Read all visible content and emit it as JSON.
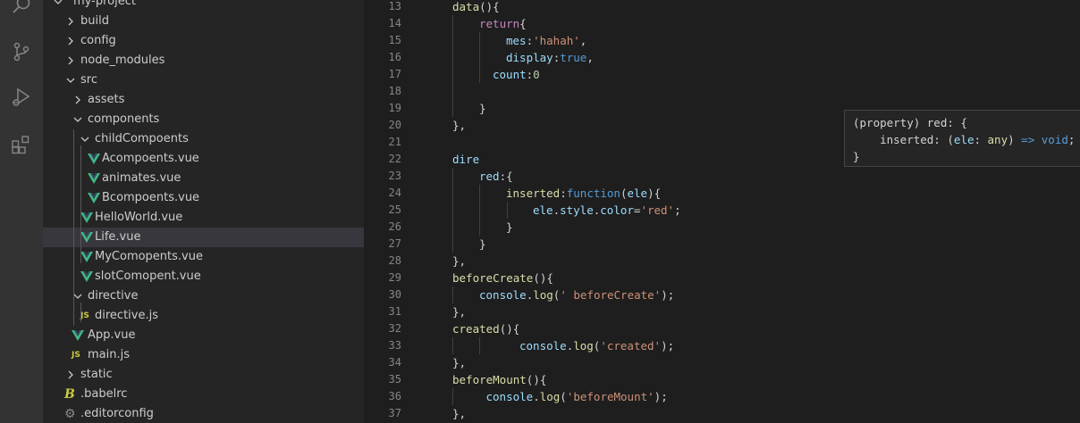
{
  "explorer": {
    "items": [
      {
        "label": "my-project",
        "kind": "folder",
        "open": true,
        "depth": 0
      },
      {
        "label": "build",
        "kind": "folder",
        "open": false,
        "depth": 1
      },
      {
        "label": "config",
        "kind": "folder",
        "open": false,
        "depth": 1
      },
      {
        "label": "node_modules",
        "kind": "folder",
        "open": false,
        "depth": 1
      },
      {
        "label": "src",
        "kind": "folder",
        "open": true,
        "depth": 1
      },
      {
        "label": "assets",
        "kind": "folder",
        "open": false,
        "depth": 2
      },
      {
        "label": "components",
        "kind": "folder",
        "open": true,
        "depth": 2
      },
      {
        "label": "childCompoents",
        "kind": "folder",
        "open": true,
        "depth": 3
      },
      {
        "label": "Acompoents.vue",
        "kind": "vue",
        "depth": 4
      },
      {
        "label": "animates.vue",
        "kind": "vue",
        "depth": 4
      },
      {
        "label": "Bcompoents.vue",
        "kind": "vue",
        "depth": 4
      },
      {
        "label": "HelloWorld.vue",
        "kind": "vue",
        "depth": 3
      },
      {
        "label": "Life.vue",
        "kind": "vue",
        "depth": 3,
        "selected": true
      },
      {
        "label": "MyComopents.vue",
        "kind": "vue",
        "depth": 3
      },
      {
        "label": "slotComopent.vue",
        "kind": "vue",
        "depth": 3
      },
      {
        "label": "directive",
        "kind": "folder",
        "open": true,
        "depth": 2
      },
      {
        "label": "directive.js",
        "kind": "js",
        "depth": 3
      },
      {
        "label": "App.vue",
        "kind": "vue",
        "depth": 2
      },
      {
        "label": "main.js",
        "kind": "js",
        "depth": 2
      },
      {
        "label": "static",
        "kind": "folder",
        "open": false,
        "depth": 1
      },
      {
        "label": ".babelrc",
        "kind": "babel",
        "depth": 1
      },
      {
        "label": ".editorconfig",
        "kind": "config",
        "depth": 1
      }
    ]
  },
  "editor": {
    "lines": [
      {
        "n": "13",
        "indent": 0,
        "tokens": [
          {
            "t": "data",
            "c": "fn"
          },
          {
            "t": "(){",
            "c": "pun"
          }
        ]
      },
      {
        "n": "14",
        "indent": 1,
        "tokens": [
          {
            "t": "return",
            "c": "kw"
          },
          {
            "t": "{",
            "c": "pun"
          }
        ]
      },
      {
        "n": "15",
        "indent": 2,
        "tokens": [
          {
            "t": "mes",
            "c": "prop"
          },
          {
            "t": ":",
            "c": "pun"
          },
          {
            "t": "'hahah'",
            "c": "str"
          },
          {
            "t": ",",
            "c": "pun"
          }
        ]
      },
      {
        "n": "16",
        "indent": 2,
        "tokens": [
          {
            "t": "display",
            "c": "prop"
          },
          {
            "t": ":",
            "c": "pun"
          },
          {
            "t": "true",
            "c": "bool"
          },
          {
            "t": ",",
            "c": "pun"
          }
        ]
      },
      {
        "n": "17",
        "indent": 1.5,
        "tokens": [
          {
            "t": "count",
            "c": "prop"
          },
          {
            "t": ":",
            "c": "pun"
          },
          {
            "t": "0",
            "c": "num"
          }
        ]
      },
      {
        "n": "18",
        "indent": 0,
        "tokens": []
      },
      {
        "n": "19",
        "indent": 1,
        "tokens": [
          {
            "t": "}",
            "c": "pun"
          }
        ]
      },
      {
        "n": "20",
        "indent": 0,
        "tokens": [
          {
            "t": "},",
            "c": "pun"
          }
        ]
      },
      {
        "n": "21",
        "indent": 0,
        "tokens": []
      },
      {
        "n": "22",
        "indent": 0,
        "tokens": [
          {
            "t": "dire",
            "c": "prop"
          }
        ]
      },
      {
        "n": "23",
        "indent": 1,
        "tokens": [
          {
            "t": "red",
            "c": "prop"
          },
          {
            "t": ":{",
            "c": "pun"
          }
        ]
      },
      {
        "n": "24",
        "indent": 2,
        "tokens": [
          {
            "t": "inserted",
            "c": "fn"
          },
          {
            "t": ":",
            "c": "pun"
          },
          {
            "t": "function",
            "c": "bool"
          },
          {
            "t": "(",
            "c": "pun"
          },
          {
            "t": "ele",
            "c": "prop"
          },
          {
            "t": "){",
            "c": "pun"
          }
        ]
      },
      {
        "n": "25",
        "indent": 3,
        "tokens": [
          {
            "t": "ele",
            "c": "prop"
          },
          {
            "t": ".",
            "c": "pun"
          },
          {
            "t": "style",
            "c": "prop"
          },
          {
            "t": ".",
            "c": "pun"
          },
          {
            "t": "color",
            "c": "prop"
          },
          {
            "t": "=",
            "c": "pun"
          },
          {
            "t": "'red'",
            "c": "str"
          },
          {
            "t": ";",
            "c": "pun"
          }
        ]
      },
      {
        "n": "26",
        "indent": 2,
        "tokens": [
          {
            "t": "}",
            "c": "pun"
          }
        ]
      },
      {
        "n": "27",
        "indent": 1,
        "tokens": [
          {
            "t": "}",
            "c": "pun"
          }
        ]
      },
      {
        "n": "28",
        "indent": 0,
        "tokens": [
          {
            "t": "},",
            "c": "pun"
          }
        ]
      },
      {
        "n": "29",
        "indent": 0,
        "tokens": [
          {
            "t": "beforeCreate",
            "c": "fn"
          },
          {
            "t": "(){",
            "c": "pun"
          }
        ]
      },
      {
        "n": "30",
        "indent": 1,
        "tokens": [
          {
            "t": "console",
            "c": "prop"
          },
          {
            "t": ".",
            "c": "pun"
          },
          {
            "t": "log",
            "c": "fn"
          },
          {
            "t": "(",
            "c": "pun"
          },
          {
            "t": "' beforeCreate'",
            "c": "str"
          },
          {
            "t": ");",
            "c": "pun"
          }
        ]
      },
      {
        "n": "31",
        "indent": 0,
        "tokens": [
          {
            "t": "},",
            "c": "pun"
          }
        ]
      },
      {
        "n": "32",
        "indent": 0,
        "tokens": [
          {
            "t": "created",
            "c": "fn"
          },
          {
            "t": "(){",
            "c": "pun"
          }
        ]
      },
      {
        "n": "33",
        "indent": 2.5,
        "tokens": [
          {
            "t": "console",
            "c": "prop"
          },
          {
            "t": ".",
            "c": "pun"
          },
          {
            "t": "log",
            "c": "fn"
          },
          {
            "t": "(",
            "c": "pun"
          },
          {
            "t": "'created'",
            "c": "str"
          },
          {
            "t": ");",
            "c": "pun"
          }
        ]
      },
      {
        "n": "34",
        "indent": 0,
        "tokens": [
          {
            "t": "},",
            "c": "pun"
          }
        ]
      },
      {
        "n": "35",
        "indent": 0,
        "tokens": [
          {
            "t": "beforeMount",
            "c": "fn"
          },
          {
            "t": "(){",
            "c": "pun"
          }
        ]
      },
      {
        "n": "36",
        "indent": 1.25,
        "tokens": [
          {
            "t": "console",
            "c": "prop"
          },
          {
            "t": ".",
            "c": "pun"
          },
          {
            "t": "log",
            "c": "fn"
          },
          {
            "t": "(",
            "c": "pun"
          },
          {
            "t": "'beforeMount'",
            "c": "str"
          },
          {
            "t": ");",
            "c": "pun"
          }
        ]
      },
      {
        "n": "37",
        "indent": 0,
        "tokens": [
          {
            "t": "},",
            "c": "pun"
          }
        ]
      }
    ]
  },
  "hover": {
    "lines": [
      [
        {
          "t": "(property) red: {",
          "c": "pun"
        }
      ],
      [
        {
          "t": "    inserted: (",
          "c": "pun"
        },
        {
          "t": "ele",
          "c": "prop"
        },
        {
          "t": ": ",
          "c": "pun"
        },
        {
          "t": "any",
          "c": "fn"
        },
        {
          "t": ") ",
          "c": "pun"
        },
        {
          "t": "=>",
          "c": "bool"
        },
        {
          "t": " ",
          "c": "pun"
        },
        {
          "t": "void",
          "c": "bool"
        },
        {
          "t": ";",
          "c": "pun"
        }
      ],
      [
        {
          "t": "}",
          "c": "pun"
        }
      ]
    ]
  },
  "icons": {
    "activity": [
      "search-icon",
      "source-control-icon",
      "run-debug-icon",
      "extensions-icon"
    ]
  },
  "colors": {
    "vue": "#41b883",
    "js": "#cbcb41",
    "selected_row": "#37373d"
  }
}
